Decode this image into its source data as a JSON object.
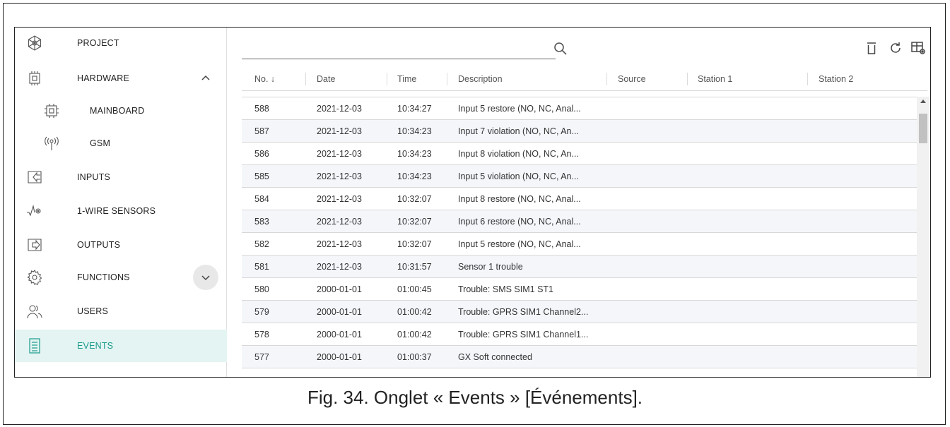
{
  "sidebar": {
    "items": [
      {
        "label": "PROJECT",
        "icon": "project-icon"
      },
      {
        "label": "HARDWARE",
        "icon": "hardware-icon",
        "expanded": true
      },
      {
        "label": "MAINBOARD",
        "icon": "mainboard-icon"
      },
      {
        "label": "GSM",
        "icon": "gsm-antenna-icon"
      },
      {
        "label": "INPUTS",
        "icon": "inputs-icon"
      },
      {
        "label": "1-WIRE SENSORS",
        "icon": "sensor-icon"
      },
      {
        "label": "OUTPUTS",
        "icon": "outputs-icon"
      },
      {
        "label": "FUNCTIONS",
        "icon": "gear-icon",
        "expanded": false
      },
      {
        "label": "USERS",
        "icon": "users-icon"
      },
      {
        "label": "EVENTS",
        "icon": "events-icon",
        "active": true
      }
    ],
    "active_color": "#1a9a8c",
    "active_bg": "#e3f4f2"
  },
  "toolbar": {
    "search_value": "",
    "tools": [
      "trash-icon",
      "refresh-icon",
      "table-settings-icon"
    ]
  },
  "table": {
    "columns": [
      "No. ↓",
      "Date",
      "Time",
      "Description",
      "Source",
      "Station 1",
      "Station 2"
    ],
    "rows": [
      {
        "no": "588",
        "date": "2021-12-03",
        "time": "10:34:27",
        "desc": "Input 5 restore (NO, NC, Anal..."
      },
      {
        "no": "587",
        "date": "2021-12-03",
        "time": "10:34:23",
        "desc": "Input 7 violation (NO, NC, An..."
      },
      {
        "no": "586",
        "date": "2021-12-03",
        "time": "10:34:23",
        "desc": "Input 8 violation (NO, NC, An..."
      },
      {
        "no": "585",
        "date": "2021-12-03",
        "time": "10:34:23",
        "desc": "Input 5 violation (NO, NC, An..."
      },
      {
        "no": "584",
        "date": "2021-12-03",
        "time": "10:32:07",
        "desc": "Input 8 restore (NO, NC, Anal..."
      },
      {
        "no": "583",
        "date": "2021-12-03",
        "time": "10:32:07",
        "desc": "Input 6 restore (NO, NC, Anal..."
      },
      {
        "no": "582",
        "date": "2021-12-03",
        "time": "10:32:07",
        "desc": "Input 5 restore (NO, NC, Anal..."
      },
      {
        "no": "581",
        "date": "2021-12-03",
        "time": "10:31:57",
        "desc": "Sensor 1 trouble"
      },
      {
        "no": "580",
        "date": "2000-01-01",
        "time": "01:00:45",
        "desc": "Trouble: SMS SIM1 ST1"
      },
      {
        "no": "579",
        "date": "2000-01-01",
        "time": "01:00:42",
        "desc": "Trouble: GPRS SIM1 Channel2..."
      },
      {
        "no": "578",
        "date": "2000-01-01",
        "time": "01:00:42",
        "desc": "Trouble: GPRS SIM1 Channel1..."
      },
      {
        "no": "577",
        "date": "2000-01-01",
        "time": "01:00:37",
        "desc": "GX Soft connected"
      }
    ]
  },
  "caption": "Fig. 34. Onglet « Events » [Événements]."
}
